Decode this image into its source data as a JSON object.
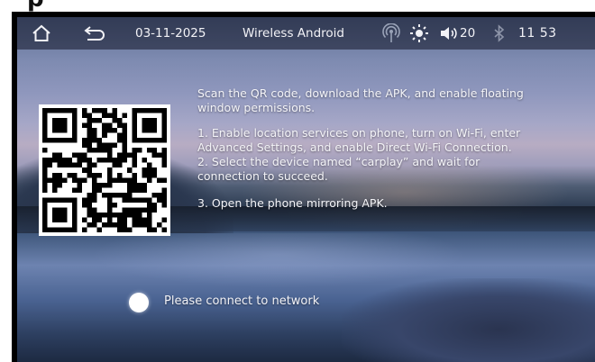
{
  "statusbar": {
    "date": "03-11-2025",
    "title": "Wireless Android",
    "volume_level": "20",
    "time": "11 53",
    "icons": [
      "home-icon",
      "back-icon",
      "hotspot-icon",
      "brightness-icon",
      "volume-icon",
      "bluetooth-icon"
    ]
  },
  "instructions": {
    "intro": "Scan the QR code, download the APK, and enable floating window permissions.",
    "step1": "1. Enable location services on phone, turn on Wi-Fi, enter Advanced Settings, and enable Direct Wi-Fi Connection.",
    "step2": "2. Select the device named “carplay” and wait for connection to succeed.",
    "step3": "3. Open the phone mirroring APK."
  },
  "network": {
    "status_text": "Please connect to network"
  },
  "colors": {
    "statusbar_bg": "#121628",
    "text": "#f4f4f8",
    "status_dot": "#ffffff"
  }
}
